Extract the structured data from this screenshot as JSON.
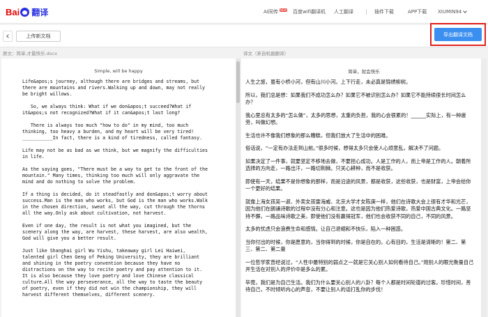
{
  "app": {
    "logo_text": "Bai",
    "logo_suffix": "翻译"
  },
  "nav": {
    "ai": "AI同传",
    "ai_badge": "NEW",
    "wifi": "百度wifi翻译机",
    "human": "人工翻译",
    "plugin": "插件下载",
    "app": "APP下载",
    "user": "XIUMIN94"
  },
  "toolbar": {
    "upload_label": "上传新文档",
    "export_label": "导出翻译文档"
  },
  "source": {
    "header": "原文：简单,才最快乐.docx",
    "title": "Simple, will be happy",
    "paragraphs": [
      "Life&apos;s journey, although there are bridges and streams, but\nthere are mountains and rivers.Walking up and down, may not really\nbe bright willows.",
      "   So, we always think: What if we don&apos;t succeed?What if\nit&apos;s not recognized?What if it can&apos;t last long?",
      "   There is always too much \"how to do\" in my mind, too much\nthinking, too heavy a burden, and my heart will be very tired!\n___________In fact, there is a kind of tiredness, called fantasy.",
      "Life may not be as bad as we think, but we magnify the difficulties\nin life.",
      "As the saying goes, \"There must be a way to get to the front of the\nmountain.\" Many times, thinking too much will only aggravate the\nmind and do nothing to solve the problem.",
      "If a thing is decided, do it steadfastly and don&apos;t worry about\nsuccess.Man is the man who works, but God is the man who works.Walk\nin the chosen direction, sweat all the way, cut through the thorns\nall the way.Only ask about cultivation, not harvest.",
      "Even if one day, the result is not what you imagined, but the\nscenery along the way, are harvest, these harvest, are also wealth,\nGod will give you a better result.",
      "Just like Shanghai girl Wu Yishu, takeaway girl Lei Haiwei,\ntalented girl Chen Geng of Peking University, they are brilliant\nand shining in the poetry convention because they have no\ndistractions on the way to recite poetry and pay attention to it.\nIt is also because they love poetry and love Chinese classical\nculture.All the way perseverance, all the way to taste the beauty\nof poetry, even if they did not win the championship, they will\nharvest different themselves, different scenery."
    ]
  },
  "target": {
    "header": "译文（来自机器翻译）",
    "title": "简单，就会快乐",
    "paragraphs": [
      "人生之旅，虽有小桥小河，但有山川小河。上下行走，未必真是锦绣柳树。",
      "所以，我们总是想：如果我们不成功怎么办？如果它不被识别怎么办？如果它不能持续很长时间怎么办？",
      "我心里总有太多的“怎么做”，太多的思想，太重的负担，我的心会很累的！______实际上，有一种疲劳，叫做幻想。",
      "生活也许不像我们想象的那么糟糕，但我们放大了生活中的困难。",
      "俗话说，“一定有办法走到山前。”很多时候，想得太多只会使人心烦意乱，解决不了问题。",
      "如果决定了一件事，就要坚定不移地去做，不要担心成功。人是工作的人，而上帝是工作的人。朝着所选择的方向走，一路出汗，一路切荆棘。只关心耕种，而不是收获。",
      "即使有一天，结果不是你想象的那样，而是沿途的风景，都是收获，这些收获，也是财富，上帝会给你一个更好的结果。",
      "就像上海女孩吴一淑、外卖女孩雷海威、北京大学才女陈庚一样，他们在诗歌大会上很有才华和光芒，因为他们在朗诵诗歌的过程中没有分心和注意。这也是因为他们热爱诗歌，热爱中国古典文化。一路坚持不懈，一路品味诗歌之美，即使他们没有赢得冠军，他们也会收获不同的自己，不同的风景。",
      "太多的忧虑只会浪费生命和感情。让自己退缩和不快乐，陷入一种困惑。",
      "当你付出的时候，你是愿意的，当你得到的时候，你是自在的。心有目的，生活是清晰的！第二、第三、第二、第二量",
      "一位哲学家曾经说过，“人性中最特别的弱点之一就是它关心别人如何看待自己。”用别人的眼光衡量自己并生活在对别人的评价中是多么的累。",
      "毕竟，我们是为自己生活。我们为什么要关心别人的八卦？每个人都是时间轮德的过客。珍惜时间，善待自己，不时倾听内心的声音，不要让别人的话打乱你的步伐！"
    ]
  }
}
